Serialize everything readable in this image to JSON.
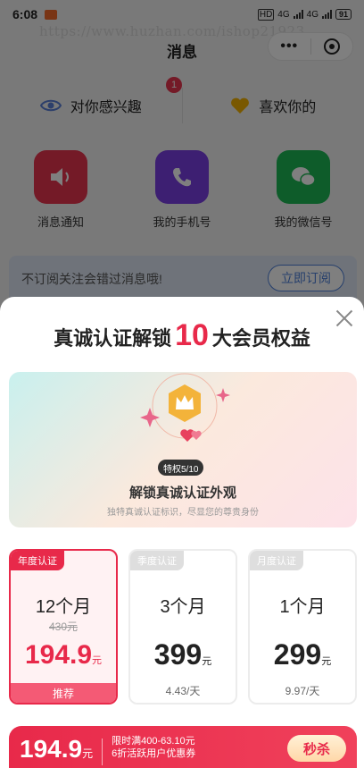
{
  "status_bar": {
    "time": "6:08",
    "net1": "4G",
    "net2": "4G",
    "hd": "HD",
    "battery": "91"
  },
  "watermark": "https://www.huzhan.com/ishop21923",
  "nav": {
    "title": "消息"
  },
  "interest": {
    "interested_label": "对你感兴趣",
    "interested_badge": "1",
    "liked_label": "喜欢你的"
  },
  "shortcuts": [
    {
      "label": "消息通知",
      "color": "#e8344e"
    },
    {
      "label": "我的手机号",
      "color": "#7b3fe4"
    },
    {
      "label": "我的微信号",
      "color": "#1db954"
    }
  ],
  "subscribe_banner": {
    "text": "不订阅关注会错过消息哦!",
    "button": "立即订阅"
  },
  "sheet": {
    "title_prefix": "真诚认证解锁",
    "title_number": "10",
    "title_suffix": "大会员权益",
    "hero": {
      "tag": "特权5/10",
      "title": "解锁真诚认证外观",
      "subtitle": "独特真诚认证标识，尽显您的尊贵身份"
    },
    "plans": [
      {
        "tag": "年度认证",
        "duration": "12个月",
        "original": "430元",
        "price": "194.9",
        "unit": "元",
        "per_day": "",
        "recommend": "推荐"
      },
      {
        "tag": "季度认证",
        "duration": "3个月",
        "original": "",
        "price": "399",
        "unit": "元",
        "per_day": "4.43/天",
        "recommend": ""
      },
      {
        "tag": "月度认证",
        "duration": "1个月",
        "original": "",
        "price": "299",
        "unit": "元",
        "per_day": "9.97/天",
        "recommend": ""
      }
    ],
    "buy": {
      "price": "194.9",
      "unit": "元",
      "info_line1": "限时满400-63.10元",
      "info_line2": "6折活跃用户优惠券",
      "button": "秒杀"
    }
  },
  "colors": {
    "accent": "#e8294a",
    "overlay": "rgba(0,0,0,0.5)"
  }
}
